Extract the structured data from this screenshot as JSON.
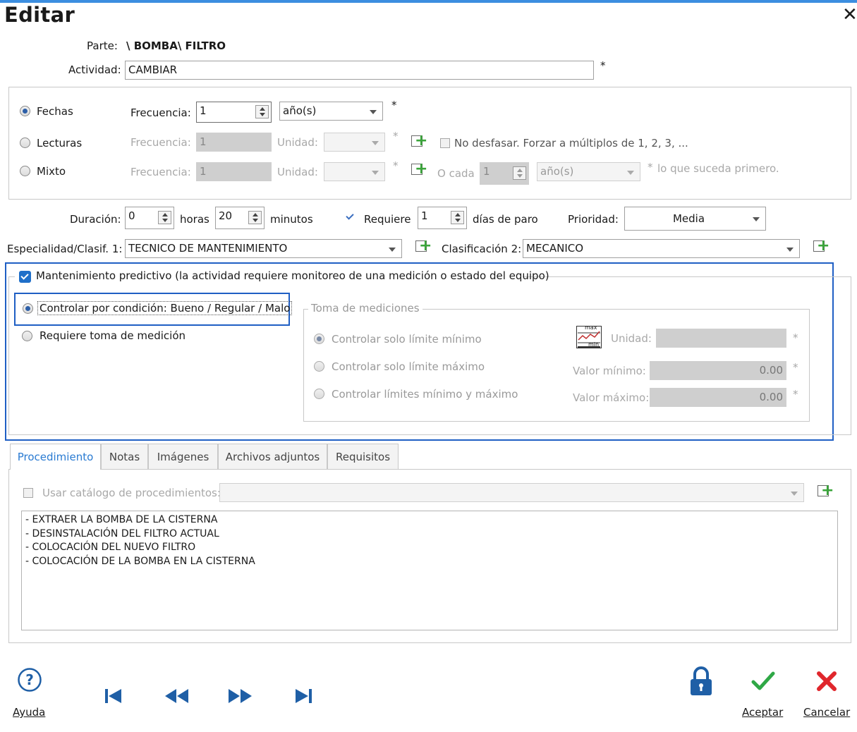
{
  "window": {
    "title": "Editar",
    "close_glyph": "✕"
  },
  "header": {
    "parte_label": "Parte:",
    "parte_value": "\\ BOMBA\\ FILTRO",
    "actividad_label": "Actividad:",
    "actividad_value": "CAMBIAR",
    "required_mark": "*"
  },
  "frequency": {
    "fechas": {
      "label": "Fechas",
      "selected": true,
      "freq_label": "Frecuencia:",
      "freq_value": "1",
      "unit_value": "año(s)"
    },
    "lecturas": {
      "label": "Lecturas",
      "freq_label": "Frecuencia:",
      "freq_value": "1",
      "unidad_label": "Unidad:",
      "no_desfasar_label": "No desfasar. Forzar a múltiplos de 1, 2, 3, ..."
    },
    "mixto": {
      "label": "Mixto",
      "freq_label": "Frecuencia:",
      "freq_value": "1",
      "unidad_label": "Unidad:",
      "ocada_label": "O cada",
      "ocada_value": "1",
      "ocada_unit": "año(s)",
      "primero_label": "lo que suceda primero."
    }
  },
  "duration": {
    "label": "Duración:",
    "hours_value": "0",
    "hours_label": "horas",
    "minutes_value": "20",
    "minutes_label": "minutos",
    "requiere_label": "Requiere",
    "requiere_checked": true,
    "dias_value": "1",
    "dias_label": "días de paro",
    "prioridad_label": "Prioridad:",
    "prioridad_value": "Media"
  },
  "classification": {
    "esp_label": "Especialidad/Clasif. 1:",
    "esp_value": "TECNICO DE MANTENIMIENTO",
    "clas2_label": "Clasificación 2:",
    "clas2_value": "MECANICO"
  },
  "predictive": {
    "checkbox_label": "Mantenimiento predictivo (la actividad requiere monitoreo de una medición o estado del equipo)",
    "checked": true,
    "controlar_label": "Controlar por condición: Bueno / Regular / Malo",
    "requiere_label": "Requiere toma de medición",
    "mediciones": {
      "title": "Toma de mediciones",
      "min_label": "Controlar solo límite mínimo",
      "max_label": "Controlar solo límite máximo",
      "both_label": "Controlar límites mínimo y máximo",
      "unidad_label": "Unidad:",
      "valor_min_label": "Valor mínimo:",
      "valor_min": "0.00",
      "valor_max_label": "Valor máximo:",
      "valor_max": "0.00",
      "chart_icon_max": "max",
      "chart_icon_min": "min"
    }
  },
  "tabs": [
    {
      "label": "Procedimiento",
      "active": true
    },
    {
      "label": "Notas"
    },
    {
      "label": "Imágenes"
    },
    {
      "label": "Archivos adjuntos"
    },
    {
      "label": "Requisitos"
    }
  ],
  "procedure": {
    "catalog_label": "Usar catálogo de procedimientos:",
    "lines": [
      "- EXTRAER LA BOMBA DE LA CISTERNA",
      "- DESINSTALACIÓN DEL FILTRO ACTUAL",
      "- COLOCACIÓN DEL NUEVO FILTRO",
      "- COLOCACIÓN DE LA BOMBA EN LA CISTERNA"
    ]
  },
  "footer": {
    "ayuda": "Ayuda",
    "aceptar": "Aceptar",
    "cancelar": "Cancelar"
  },
  "colors": {
    "accent": "#1f6fc9",
    "tab_active": "#2a7bd2",
    "accept": "#2fa846",
    "cancel": "#e0262c",
    "help": "#1f5fa6"
  }
}
